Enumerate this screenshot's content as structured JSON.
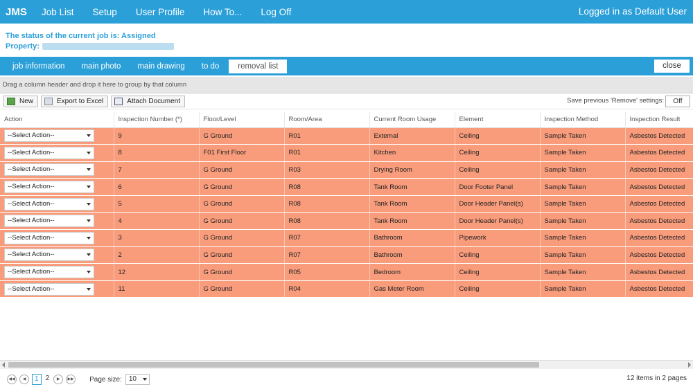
{
  "nav": {
    "brand": "JMS",
    "links": [
      "Job List",
      "Setup",
      "User Profile",
      "How To...",
      "Log Off"
    ],
    "logged_in": "Logged in as Default User"
  },
  "status": {
    "line": "The status of the current job is: Assigned",
    "property_label": "Property:"
  },
  "tabs": [
    "job information",
    "main photo",
    "main drawing",
    "to do",
    "removal list"
  ],
  "close_label": "close",
  "group_hint": "Drag a column header and drop it here to group by that column",
  "toolbar": {
    "new_label": "New",
    "export_label": "Export to Excel",
    "attach_label": "Attach Document",
    "save_prev_label": "Save previous 'Remove' settings:",
    "off_label": "Off"
  },
  "columns": [
    "Action",
    "Inspection Number (*)",
    "Floor/Level",
    "Room/Area",
    "Current Room Usage",
    "Element",
    "Inspection Method",
    "Inspection Result"
  ],
  "rows": [
    {
      "action": "--Select Action--",
      "num": "9",
      "floor": "G Ground",
      "room": "R01",
      "usage": "External",
      "element": "Ceiling",
      "method": "Sample Taken",
      "result": "Asbestos Detected"
    },
    {
      "action": "--Select Action--",
      "num": "8",
      "floor": "F01 First Floor",
      "room": "R01",
      "usage": "Kitchen",
      "element": "Ceiling",
      "method": "Sample Taken",
      "result": "Asbestos Detected"
    },
    {
      "action": "--Select Action--",
      "num": "7",
      "floor": "G Ground",
      "room": "R03",
      "usage": "Drying Room",
      "element": "Ceiling",
      "method": "Sample Taken",
      "result": "Asbestos Detected"
    },
    {
      "action": "--Select Action--",
      "num": "6",
      "floor": "G Ground",
      "room": "R08",
      "usage": "Tank Room",
      "element": "Door Footer Panel",
      "method": "Sample Taken",
      "result": "Asbestos Detected"
    },
    {
      "action": "--Select Action--",
      "num": "5",
      "floor": "G Ground",
      "room": "R08",
      "usage": "Tank Room",
      "element": "Door Header Panel(s)",
      "method": "Sample Taken",
      "result": "Asbestos Detected"
    },
    {
      "action": "--Select Action--",
      "num": "4",
      "floor": "G Ground",
      "room": "R08",
      "usage": "Tank Room",
      "element": "Door Header Panel(s)",
      "method": "Sample Taken",
      "result": "Asbestos Detected"
    },
    {
      "action": "--Select Action--",
      "num": "3",
      "floor": "G Ground",
      "room": "R07",
      "usage": "Bathroom",
      "element": "Pipework",
      "method": "Sample Taken",
      "result": "Asbestos Detected"
    },
    {
      "action": "--Select Action--",
      "num": "2",
      "floor": "G Ground",
      "room": "R07",
      "usage": "Bathroom",
      "element": "Ceiling",
      "method": "Sample Taken",
      "result": "Asbestos Detected"
    },
    {
      "action": "--Select Action--",
      "num": "12",
      "floor": "G Ground",
      "room": "R05",
      "usage": "Bedroom",
      "element": "Ceiling",
      "method": "Sample Taken",
      "result": "Asbestos Detected"
    },
    {
      "action": "--Select Action--",
      "num": "11",
      "floor": "G Ground",
      "room": "R04",
      "usage": "Gas Meter Room",
      "element": "Ceiling",
      "method": "Sample Taken",
      "result": "Asbestos Detected"
    }
  ],
  "pager": {
    "pages": [
      "1",
      "2"
    ],
    "current": "1",
    "page_size_label": "Page size:",
    "page_size": "10",
    "info": "12 items in 2 pages"
  },
  "colors": {
    "accent": "#2a9fd8",
    "row_highlight": "#f89c7c"
  },
  "icons": {
    "first": "first-page-icon",
    "prev": "prev-page-icon",
    "next": "next-page-icon",
    "last": "last-page-icon"
  }
}
